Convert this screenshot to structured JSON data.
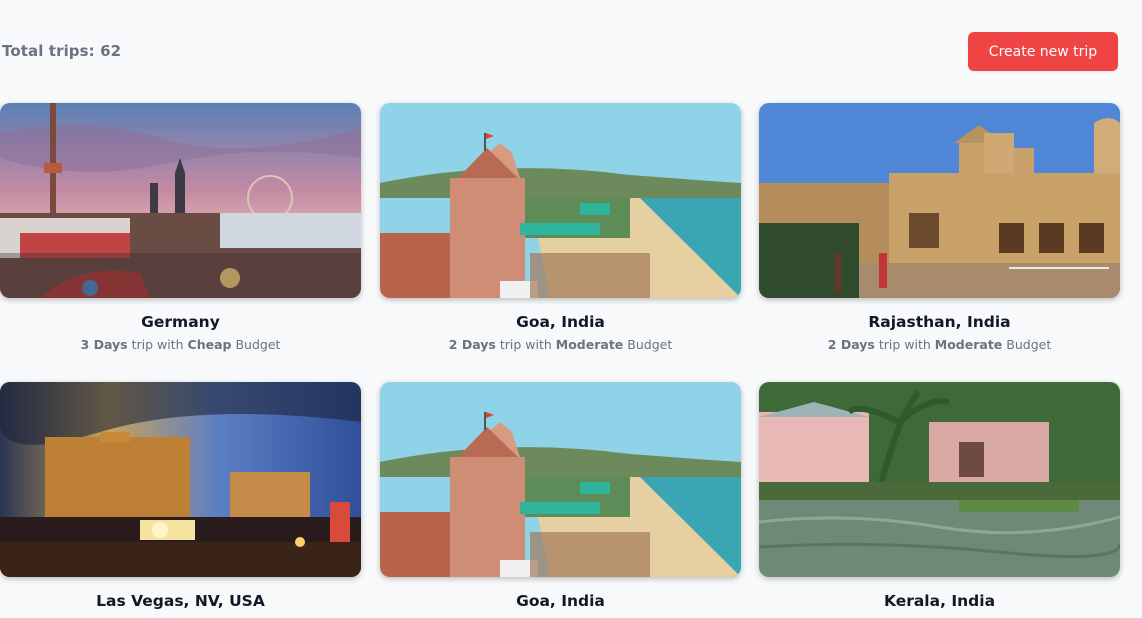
{
  "header": {
    "total_trips_label": "Total trips: 62",
    "create_button_label": "Create new trip",
    "accent_color": "#ef4444"
  },
  "trips": [
    {
      "title": "Germany",
      "days": "3 Days",
      "trip_with": "trip with",
      "budget": "Cheap",
      "budget_word": "Budget",
      "image": "oktoberfest-fairground"
    },
    {
      "title": "Goa, India",
      "days": "2 Days",
      "trip_with": "trip with",
      "budget": "Moderate",
      "budget_word": "Budget",
      "image": "goa-temple-beach"
    },
    {
      "title": "Rajasthan, India",
      "days": "2 Days",
      "trip_with": "trip with",
      "budget": "Moderate",
      "budget_word": "Budget",
      "image": "rajasthan-palace"
    },
    {
      "title": "Las Vegas, NV, USA",
      "image": "las-vegas-bellagio"
    },
    {
      "title": "Goa, India",
      "image": "goa-temple-beach"
    },
    {
      "title": "Kerala, India",
      "image": "kerala-backwaters"
    }
  ]
}
